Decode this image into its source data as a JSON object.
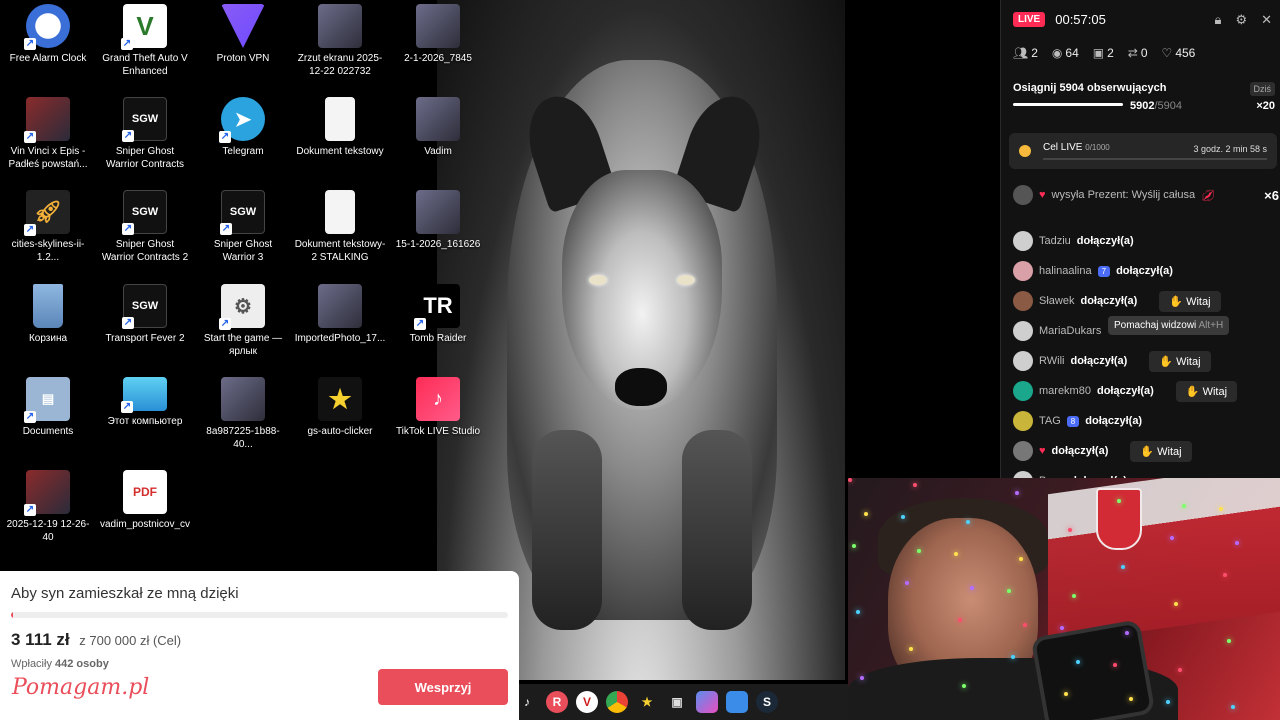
{
  "desktop": {
    "icons": [
      {
        "label": "Free Alarm Clock",
        "icon": "alarm-clock-icon"
      },
      {
        "label": "Grand Theft Auto V Enhanced",
        "icon": "gta-icon"
      },
      {
        "label": "Proton VPN",
        "icon": "vpn-icon"
      },
      {
        "label": "Zrzut ekranu 2025-12-22 022732",
        "icon": "image-file-icon"
      },
      {
        "label": "2-1-2026_7845",
        "icon": "image-file-icon"
      },
      {
        "label": "Vin Vinci x Epis - Padłeś powstań...",
        "icon": "video-file-icon"
      },
      {
        "label": "Sniper Ghost Warrior Contracts",
        "icon": "game-icon"
      },
      {
        "label": "Telegram",
        "icon": "telegram-icon"
      },
      {
        "label": "Dokument tekstowy",
        "icon": "text-file-icon"
      },
      {
        "label": "Vadim",
        "icon": "image-file-icon"
      },
      {
        "label": "cities-skylines-ii-1.2...",
        "icon": "rocket-icon"
      },
      {
        "label": "Sniper Ghost Warrior Contracts 2",
        "icon": "game-icon"
      },
      {
        "label": "Sniper Ghost Warrior 3",
        "icon": "game-icon"
      },
      {
        "label": "Dokument tekstowy-2 STALKING",
        "icon": "text-file-icon"
      },
      {
        "label": "15-1-2026_161626",
        "icon": "image-file-icon"
      },
      {
        "label": "Корзина",
        "icon": "recycle-bin-icon"
      },
      {
        "label": "Transport Fever 2",
        "icon": "game-icon"
      },
      {
        "label": "Start the game — ярлык",
        "icon": "settings-file-icon"
      },
      {
        "label": "ImportedPhoto_17...",
        "icon": "image-file-icon"
      },
      {
        "label": "Tomb Raider",
        "icon": "tomb-raider-icon"
      },
      {
        "label": "Documents",
        "icon": "folder-icon"
      },
      {
        "label": "Этот компьютер",
        "icon": "computer-icon"
      },
      {
        "label": "8a987225-1b88-40...",
        "icon": "image-file-icon"
      },
      {
        "label": "gs-auto-clicker",
        "icon": "star-icon"
      },
      {
        "label": "TikTok LIVE Studio",
        "icon": "tiktok-icon"
      },
      {
        "label": "2025-12-19 12-26-40",
        "icon": "video-file-icon"
      },
      {
        "label": "vadim_postnicov_cv",
        "icon": "pdf-icon"
      }
    ]
  },
  "fundraiser": {
    "title": "Aby syn zamieszkał ze mną dzięki",
    "raised": "3 111 zł",
    "goal_text": "z 700 000 zł (Cel)",
    "donors_label": "Wpłaciły",
    "donors_count": "442 osoby",
    "logo": "Pomagam.pl",
    "support_button": "Wesprzyj",
    "progress_fraction": 0.0044,
    "accent": "#e94e5a"
  },
  "live": {
    "badge": "LIVE",
    "time": "00:57:05",
    "stats": {
      "users": "2",
      "viewers": "64",
      "gifts": "2",
      "shares": "0",
      "likes": "456"
    },
    "goal": {
      "title": "Osiągnij 5904 obserwujących",
      "today": "Dziś",
      "current": "5902",
      "target": "/5904",
      "multiplier": "×20"
    },
    "cel": {
      "label": "Cel LIVE",
      "progress": "0/1000",
      "time_left": "3 godz. 2 min 58 s"
    },
    "gift_message": "wysyła Prezent: Wyślij całusa",
    "gift_count": "×6",
    "chat": [
      {
        "user": "Tadziu",
        "action": "dołączył(a)",
        "level": "",
        "witaj": false,
        "avatar": "#cfcfcf"
      },
      {
        "user": "halinaalina",
        "action": "dołączył(a)",
        "level": "7",
        "witaj": false,
        "avatar": "#d9a0a8"
      },
      {
        "user": "Sławek",
        "action": "dołączył(a)",
        "level": "",
        "witaj": true,
        "avatar": "#8a5a44"
      },
      {
        "user": "MariaDukars",
        "action": "",
        "level": "",
        "witaj": false,
        "avatar": "#cfcfcf"
      },
      {
        "user": "RWili",
        "action": "dołączył(a)",
        "level": "",
        "witaj": true,
        "avatar": "#cfcfcf"
      },
      {
        "user": "marekm80",
        "action": "dołączył(a)",
        "level": "",
        "witaj": true,
        "avatar": "#1aa78c"
      },
      {
        "user": "TAG",
        "action": "dołączył(a)",
        "level": "8",
        "witaj": false,
        "avatar": "#c9b53a"
      },
      {
        "user": "",
        "action": "dołączył(a)",
        "level": "",
        "witaj": true,
        "avatar": "#777"
      },
      {
        "user": "Baca",
        "action": "dołączył(a)",
        "level": "",
        "witaj": false,
        "avatar": "#cfcfcf"
      }
    ],
    "witaj_label": "Witaj",
    "tooltip": {
      "text": "Pomachaj widzowi",
      "shortcut": "Alt+H"
    },
    "accent": "#fe2c55"
  }
}
